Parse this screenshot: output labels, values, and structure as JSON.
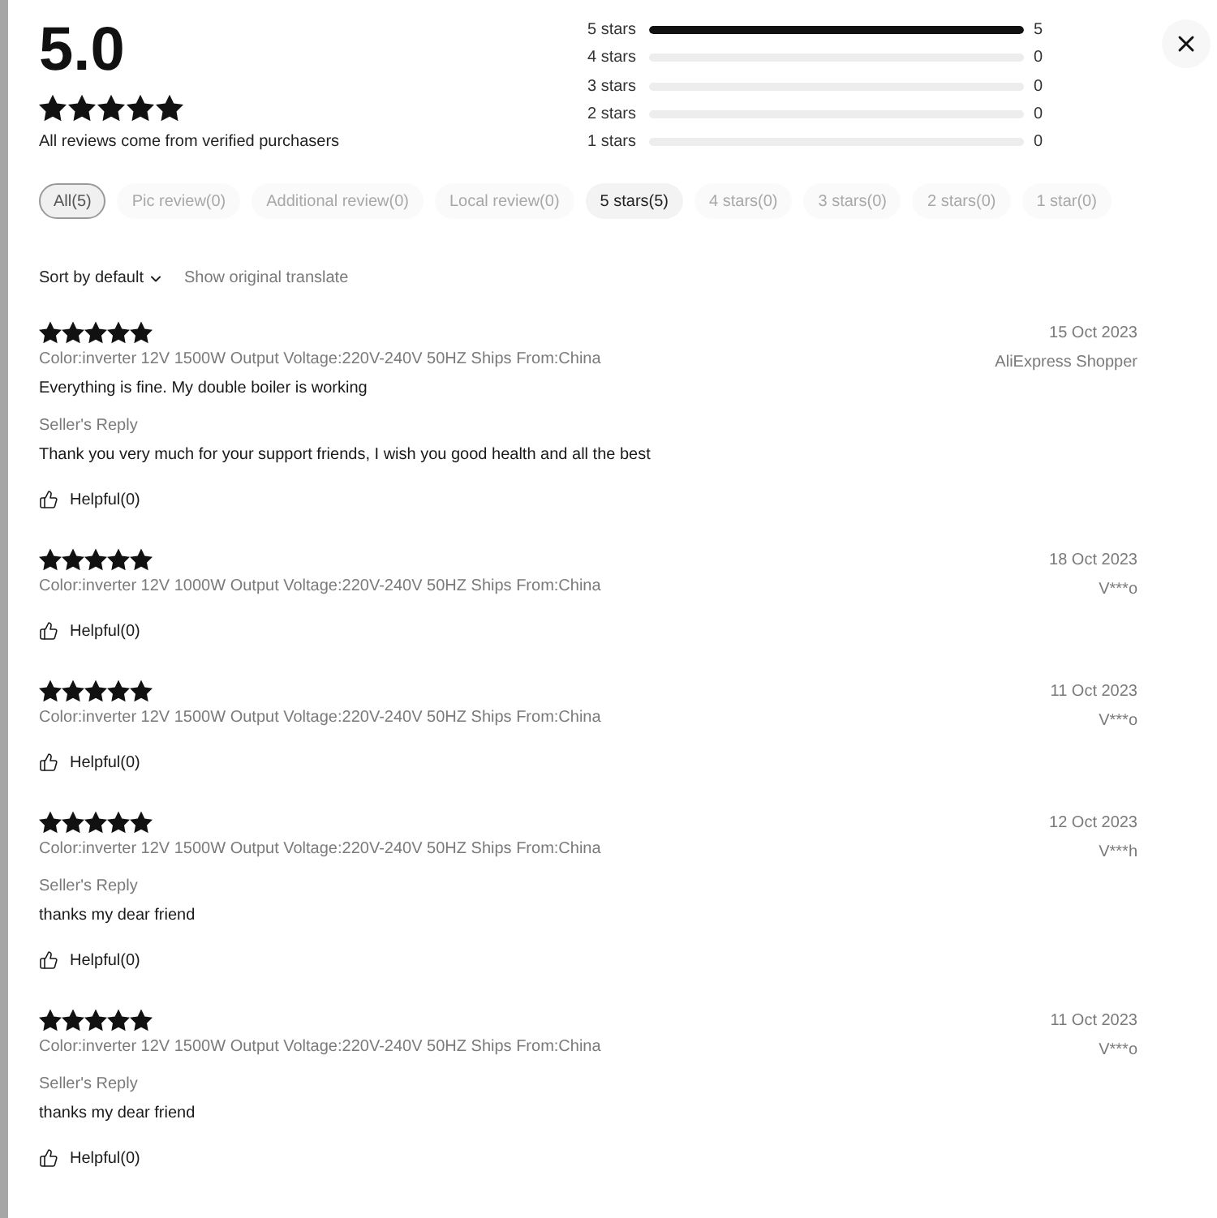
{
  "summary": {
    "score": "5.0",
    "stars": 5,
    "note": "All reviews come from verified purchasers"
  },
  "distribution": [
    {
      "label": "5 stars",
      "level": 1,
      "count": "5"
    },
    {
      "label": "4 stars",
      "level": 0,
      "count": "0"
    },
    {
      "label": "3 stars",
      "level": 0,
      "count": "0"
    },
    {
      "label": "2 stars",
      "level": 0,
      "count": "0"
    },
    {
      "label": "1 stars",
      "level": 0,
      "count": "0"
    }
  ],
  "filters": [
    {
      "label": "All(5)",
      "selected": true,
      "disabled": false
    },
    {
      "label": "Pic review(0)",
      "selected": false,
      "disabled": true
    },
    {
      "label": "Additional review(0)",
      "selected": false,
      "disabled": true
    },
    {
      "label": "Local review(0)",
      "selected": false,
      "disabled": true
    },
    {
      "label": "5 stars(5)",
      "selected": false,
      "disabled": false
    },
    {
      "label": "4 stars(0)",
      "selected": false,
      "disabled": true
    },
    {
      "label": "3 stars(0)",
      "selected": false,
      "disabled": true
    },
    {
      "label": "2 stars(0)",
      "selected": false,
      "disabled": true
    },
    {
      "label": "1 star(0)",
      "selected": false,
      "disabled": true
    }
  ],
  "sort": {
    "label": "Sort by default"
  },
  "translate_link": "Show original translate",
  "reviews": [
    {
      "stars": 5,
      "date": "15 Oct 2023",
      "variant": "Color:inverter 12V 1500W Output Voltage:220V-240V 50HZ Ships From:China",
      "author": "AliExpress Shopper",
      "text": "Everything is fine. My double boiler is working",
      "seller_reply": {
        "label": "Seller's Reply",
        "text": "Thank you very much for your support friends, I wish you good health and all the best"
      },
      "helpful": "Helpful(0)"
    },
    {
      "stars": 5,
      "date": "18 Oct 2023",
      "variant": "Color:inverter 12V 1000W Output Voltage:220V-240V 50HZ Ships From:China",
      "author": "V***o",
      "helpful": "Helpful(0)"
    },
    {
      "stars": 5,
      "date": "11 Oct 2023",
      "variant": "Color:inverter 12V 1500W Output Voltage:220V-240V 50HZ Ships From:China",
      "author": "V***o",
      "helpful": "Helpful(0)"
    },
    {
      "stars": 5,
      "date": "12 Oct 2023",
      "variant": "Color:inverter 12V 1500W Output Voltage:220V-240V 50HZ Ships From:China",
      "author": "V***h",
      "seller_reply": {
        "label": "Seller's Reply",
        "text": "thanks my dear friend"
      },
      "helpful": "Helpful(0)"
    },
    {
      "stars": 5,
      "date": "11 Oct 2023",
      "variant": "Color:inverter 12V 1500W Output Voltage:220V-240V 50HZ Ships From:China",
      "author": "V***o",
      "seller_reply": {
        "label": "Seller's Reply",
        "text": "thanks my dear friend"
      },
      "helpful": "Helpful(0)"
    }
  ]
}
